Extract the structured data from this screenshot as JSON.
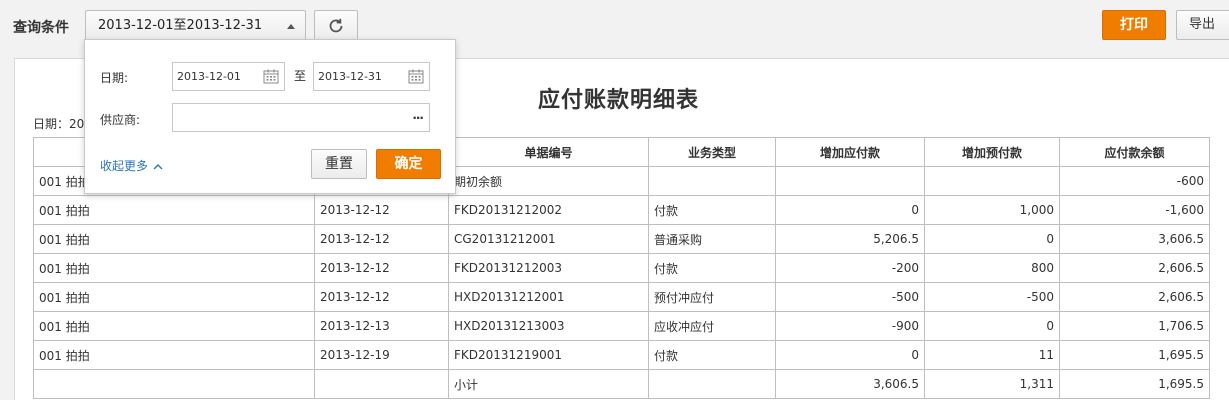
{
  "toolbar": {
    "query_label": "查询条件",
    "range_value": "2013-12-01至2013-12-31",
    "print_label": "打印",
    "export_label": "导出"
  },
  "report": {
    "title": "应付账款明细表",
    "date_prefix": "日期：",
    "date_value": "20",
    "columns": [
      "",
      "",
      "单据编号",
      "业务类型",
      "增加应付款",
      "增加预付款",
      "应付款余额"
    ],
    "rows": [
      [
        "001 拍拍",
        "",
        "期初余额",
        "",
        "",
        "",
        "-600"
      ],
      [
        "001 拍拍",
        "2013-12-12",
        "FKD20131212002",
        "付款",
        "0",
        "1,000",
        "-1,600"
      ],
      [
        "001 拍拍",
        "2013-12-12",
        "CG20131212001",
        "普通采购",
        "5,206.5",
        "0",
        "3,606.5"
      ],
      [
        "001 拍拍",
        "2013-12-12",
        "FKD20131212003",
        "付款",
        "-200",
        "800",
        "2,606.5"
      ],
      [
        "001 拍拍",
        "2013-12-12",
        "HXD20131212001",
        "预付冲应付",
        "-500",
        "-500",
        "2,606.5"
      ],
      [
        "001 拍拍",
        "2013-12-13",
        "HXD20131213003",
        "应收冲应付",
        "-900",
        "0",
        "1,706.5"
      ],
      [
        "001 拍拍",
        "2013-12-19",
        "FKD20131219001",
        "付款",
        "0",
        "11",
        "1,695.5"
      ],
      [
        "",
        "",
        "小计",
        "",
        "3,606.5",
        "1,311",
        "1,695.5"
      ]
    ]
  },
  "filter_popover": {
    "date_label": "日期:",
    "start_date": "2013-12-01",
    "to_label": "至",
    "end_date": "2013-12-31",
    "supplier_label": "供应商:",
    "supplier_value": "",
    "ellipsis": "···",
    "collapse_label": "收起更多",
    "reset_label": "重置",
    "confirm_label": "确定"
  },
  "colors": {
    "accent": "#f07c00",
    "link": "#2b75c0",
    "border": "#bfbfbf"
  }
}
